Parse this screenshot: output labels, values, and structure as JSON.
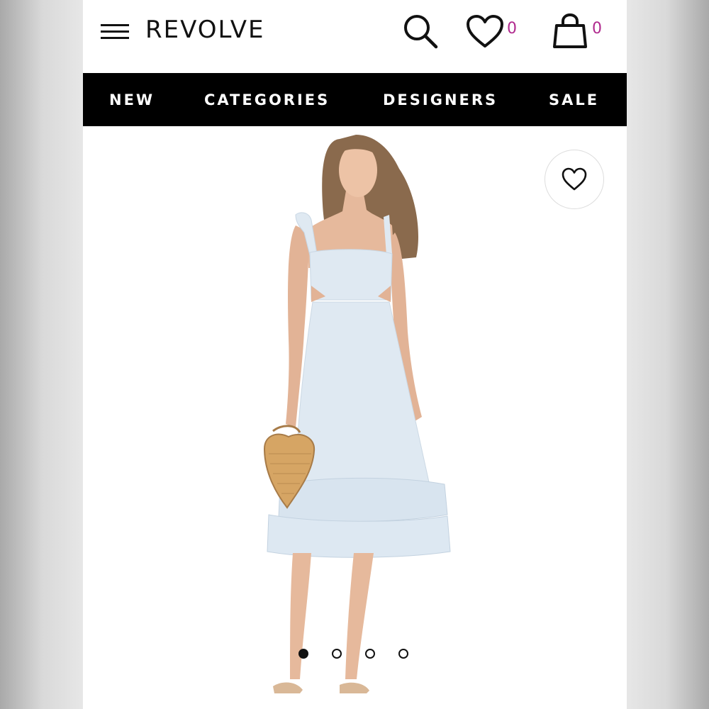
{
  "header": {
    "brand": "REVOLVE",
    "wishlist_count": "0",
    "bag_count": "0"
  },
  "nav": {
    "items": [
      "NEW",
      "CATEGORIES",
      "DESIGNERS",
      "SALE"
    ]
  },
  "icons": {
    "menu": "hamburger-menu-icon",
    "search": "search-icon",
    "wishlist": "heart-icon",
    "bag": "shopping-bag-icon",
    "favorite": "heart-outline-icon"
  },
  "product": {
    "image": "model wearing light blue ruffle cut-out midi dress holding wicker bag",
    "carousel_total": 4,
    "carousel_active": 1
  },
  "colors": {
    "accent_count": "#b02a8e",
    "navbar_bg": "#000000",
    "dress": "#dfe9f2"
  }
}
